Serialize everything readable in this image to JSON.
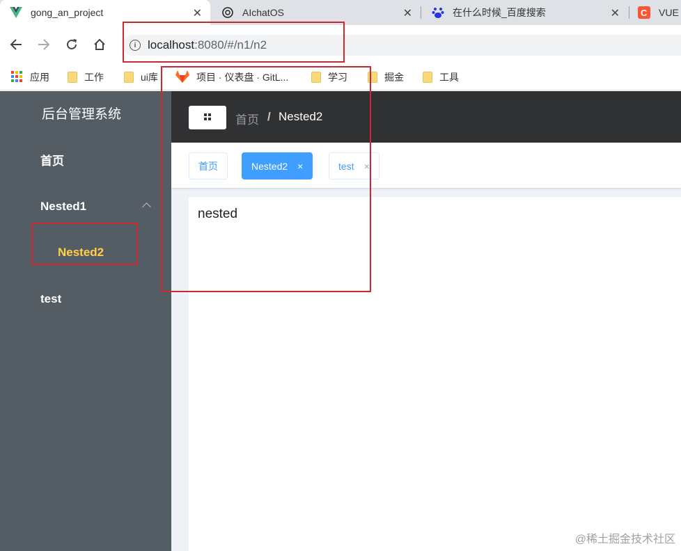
{
  "browser": {
    "tabs": [
      {
        "title": "gong_an_project",
        "active": true,
        "icon": "vue-logo-icon"
      },
      {
        "title": "AIchatOS",
        "active": false,
        "icon": "openai-logo-icon"
      },
      {
        "title": "在什么时候_百度搜索",
        "active": false,
        "icon": "baidu-logo-icon"
      },
      {
        "title": "VUE",
        "active": false,
        "icon": "csdn-logo-icon"
      }
    ],
    "url_host": "localhost",
    "url_path": ":8080/#/n1/n2",
    "bookmarks": [
      "应用",
      "工作",
      "ui库",
      "项目 · 仪表盘 · GitL...",
      "学习",
      "掘金",
      "工具"
    ]
  },
  "sidebar": {
    "title": "后台管理系统",
    "items": [
      {
        "label": "首页"
      },
      {
        "label": "Nested1"
      },
      {
        "label": "Nested2"
      },
      {
        "label": "test"
      }
    ]
  },
  "header": {
    "breadcrumb": [
      "首页",
      "/",
      "Nested2"
    ]
  },
  "tags": [
    {
      "label": "首页",
      "active": false,
      "close": ""
    },
    {
      "label": "Nested2",
      "active": true,
      "close": "×"
    },
    {
      "label": "test",
      "active": false,
      "close": "×"
    }
  ],
  "content": {
    "text": "nested"
  },
  "watermark": "@稀土掘金技术社区",
  "colors": {
    "sidebar_bg": "#545c64",
    "active_menu": "#ffd04b",
    "header_bg": "#303133",
    "tag_active": "#409eff",
    "annotation": "#d0262f"
  }
}
